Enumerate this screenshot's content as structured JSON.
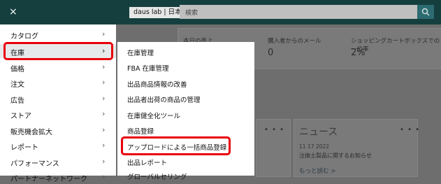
{
  "header": {
    "brand": "daus lab | 日本",
    "search_placeholder": "検索"
  },
  "metrics": [
    {
      "label": "本日の売上",
      "value": ""
    },
    {
      "label": "購入者からのメール",
      "value": "0"
    },
    {
      "label": "ショッピングカートボックスでの一位率",
      "value": "2%"
    }
  ],
  "widgets": {
    "dots": "• • •"
  },
  "news": {
    "title": "ニュース",
    "date": "11 17 2022",
    "item": "注換土製品に関するお知らせ",
    "more": "もっと読む >"
  },
  "sidebar": {
    "close": "×",
    "items": [
      {
        "label": "カタログ"
      },
      {
        "label": "在庫"
      },
      {
        "label": "価格"
      },
      {
        "label": "注文"
      },
      {
        "label": "広告"
      },
      {
        "label": "ストア"
      },
      {
        "label": "販売機会拡大"
      },
      {
        "label": "レポート"
      },
      {
        "label": "パフォーマンス"
      },
      {
        "label": "パートナーネットワーク"
      }
    ],
    "chevron": "›"
  },
  "submenu": {
    "items": [
      {
        "label": "在庫管理"
      },
      {
        "label": "FBA 在庫管理"
      },
      {
        "label": "出品商品情報の改善"
      },
      {
        "label": "出品者出荷の商品の管理"
      },
      {
        "label": "在庫健全化ツール"
      },
      {
        "label": "商品登録"
      },
      {
        "label": "アップロードによる一括商品登録"
      },
      {
        "label": "出品レポート"
      },
      {
        "label": "グローバルセリング"
      }
    ]
  },
  "colors": {
    "header_bg": "#153f3f",
    "highlight": "#e8000b"
  }
}
